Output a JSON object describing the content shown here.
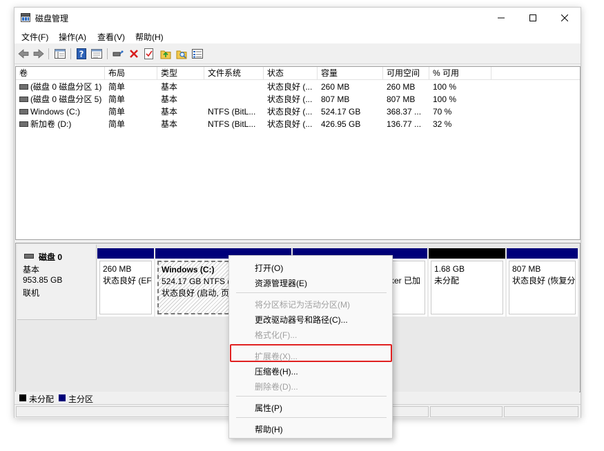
{
  "window": {
    "title": "磁盘管理",
    "controls": {
      "minimize": "minimize-icon",
      "maximize": "maximize-icon",
      "close": "close-icon"
    }
  },
  "menubar": {
    "items": [
      "文件(F)",
      "操作(A)",
      "查看(V)",
      "帮助(H)"
    ]
  },
  "toolbar": {
    "buttons": [
      "back-icon",
      "forward-icon",
      "console-tree-icon",
      "help-icon",
      "properties-icon",
      "connect-drive-icon",
      "delete-icon",
      "check-icon",
      "up-folder-icon",
      "search-folder-icon",
      "list-view-icon"
    ]
  },
  "volume_list": {
    "columns": [
      "卷",
      "布局",
      "类型",
      "文件系统",
      "状态",
      "容量",
      "可用空间",
      "% 可用"
    ],
    "rows": [
      [
        "(磁盘 0 磁盘分区 1)",
        "简单",
        "基本",
        "",
        "状态良好 (...",
        "260 MB",
        "260 MB",
        "100 %"
      ],
      [
        "(磁盘 0 磁盘分区 5)",
        "简单",
        "基本",
        "",
        "状态良好 (...",
        "807 MB",
        "807 MB",
        "100 %"
      ],
      [
        "Windows (C:)",
        "简单",
        "基本",
        "NTFS (BitL...",
        "状态良好 (...",
        "524.17 GB",
        "368.37 ...",
        "70 %"
      ],
      [
        "新加卷 (D:)",
        "简单",
        "基本",
        "NTFS (BitL...",
        "状态良好 (...",
        "426.95 GB",
        "136.77 ...",
        "32 %"
      ]
    ]
  },
  "disk": {
    "name": "磁盘 0",
    "type": "基本",
    "size": "953.85 GB",
    "status": "联机",
    "partitions": [
      {
        "line1": "260 MB",
        "line2": "状态良好 (EF"
      },
      {
        "title": "Windows (C:)",
        "line1": "524.17 GB NTFS (",
        "line2": "状态良好 (启动, 页"
      },
      {
        "line1": "",
        "line2": "ker 已加"
      },
      {
        "line1": "1.68 GB",
        "line2": "未分配"
      },
      {
        "line1": "807 MB",
        "line2": "状态良好 (恢复分"
      }
    ]
  },
  "legend": {
    "unallocated": "未分配",
    "primary": "主分区"
  },
  "context_menu": {
    "items": [
      {
        "label": "打开(O)",
        "disabled": false
      },
      {
        "label": "资源管理器(E)",
        "disabled": false
      },
      {
        "label": "将分区标记为活动分区(M)",
        "disabled": true
      },
      {
        "label": "更改驱动器号和路径(C)...",
        "disabled": false
      },
      {
        "label": "格式化(F)...",
        "disabled": true
      },
      {
        "label": "扩展卷(X)...",
        "disabled": true
      },
      {
        "label": "压缩卷(H)...",
        "disabled": false
      },
      {
        "label": "删除卷(D)...",
        "disabled": true
      },
      {
        "label": "属性(P)",
        "disabled": false
      },
      {
        "label": "帮助(H)",
        "disabled": false
      }
    ]
  },
  "colors": {
    "primary_partition": "#00007a",
    "unallocated": "#000000",
    "highlight_border": "#e02020"
  }
}
